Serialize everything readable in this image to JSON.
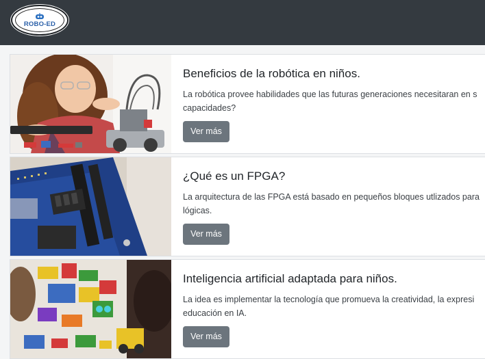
{
  "navbar": {
    "logo_text": "ROBO-ED",
    "background": "#343a40"
  },
  "cards": [
    {
      "title": "Beneficios de la robótica en niños.",
      "text_line1": "La robótica provee habilidades que las futuras generaciones necesitaran en s",
      "text_line2": "capacidades?",
      "button_label": "Ver más",
      "image": "girl-with-robot-kit-photo"
    },
    {
      "title": "¿Qué es un FPGA?",
      "text_line1": "La arquitectura de las FPGA está basado en pequeños bloques utlizados para",
      "text_line2": "lógicas.",
      "button_label": "Ver más",
      "image": "fpga-board-photo"
    },
    {
      "title": "Inteligencia artificial adaptada para niños.",
      "text_line1": "La idea es implementar la tecnología que promueva la creatividad, la expresi",
      "text_line2": "educación en IA.",
      "button_label": "Ver más",
      "image": "kids-with-lego-robots-photo"
    }
  ],
  "colors": {
    "button": "#6c757d",
    "title": "#212529",
    "text": "#3a3f44",
    "card_border": "#dcdfe3"
  }
}
